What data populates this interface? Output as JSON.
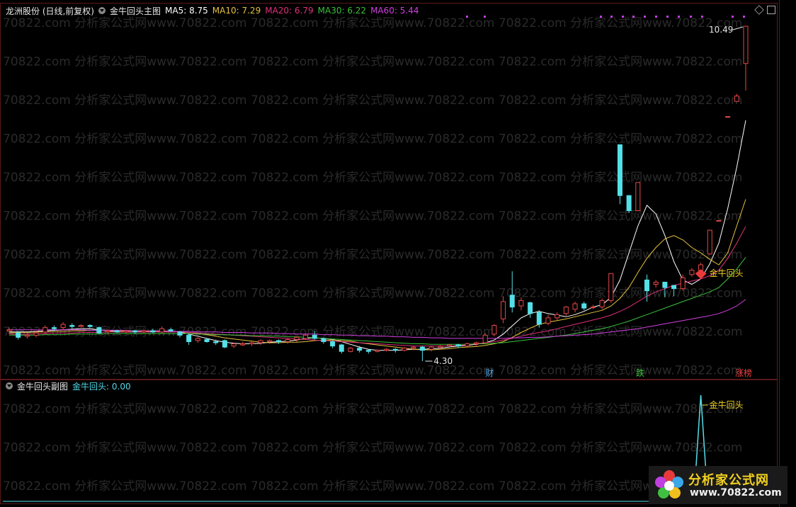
{
  "stock_title": "龙洲股份 (日线,前复权)",
  "main_indicator": "金牛回头主图",
  "ma": [
    {
      "label": "MA5: 8.75",
      "color": "#ffffff"
    },
    {
      "label": "MA10: 7.29",
      "color": "#e6c23c"
    },
    {
      "label": "MA20: 6.79",
      "color": "#e0307a"
    },
    {
      "label": "MA30: 6.22",
      "color": "#3cc03c"
    },
    {
      "label": "MA60: 5.44",
      "color": "#d040e0"
    }
  ],
  "sub_indicator": "金牛回头副图",
  "sub_value": "金牛回头: 0.00",
  "logo": {
    "cn": "分析家公式网",
    "url": "www.70822.com"
  },
  "watermark": "70822.com  分析家公式网www.70822.com",
  "chart_data": {
    "type": "candlestick",
    "title": "龙洲股份 (日线,前复权)",
    "high_label": "10.49",
    "low_label": "4.30",
    "signal_label": "金牛回头",
    "event_labels": [
      {
        "text": "财",
        "color": "#4fa8e8"
      },
      {
        "text": "跌",
        "color": "#3cc03c"
      },
      {
        "text": "涨榜",
        "color": "#e84040"
      }
    ],
    "candles": [
      [
        4.86,
        4.88,
        4.8,
        4.92
      ],
      [
        4.82,
        4.74,
        4.7,
        4.86
      ],
      [
        4.76,
        4.78,
        4.72,
        4.82
      ],
      [
        4.78,
        4.82,
        4.74,
        4.86
      ],
      [
        4.84,
        4.92,
        4.8,
        4.96
      ],
      [
        4.92,
        4.9,
        4.86,
        4.96
      ],
      [
        4.92,
        4.98,
        4.88,
        5.02
      ],
      [
        4.96,
        4.94,
        4.9,
        5.0
      ],
      [
        4.94,
        4.96,
        4.92,
        4.98
      ],
      [
        4.96,
        4.94,
        4.92,
        4.98
      ],
      [
        4.92,
        4.82,
        4.8,
        4.94
      ],
      [
        4.84,
        4.86,
        4.8,
        4.88
      ],
      [
        4.86,
        4.84,
        4.82,
        4.88
      ],
      [
        4.84,
        4.86,
        4.82,
        4.88
      ],
      [
        4.86,
        4.84,
        4.8,
        4.88
      ],
      [
        4.84,
        4.86,
        4.82,
        4.88
      ],
      [
        4.86,
        4.84,
        4.82,
        4.9
      ],
      [
        4.84,
        4.9,
        4.82,
        4.94
      ],
      [
        4.88,
        4.86,
        4.84,
        4.92
      ],
      [
        4.84,
        4.78,
        4.74,
        4.86
      ],
      [
        4.78,
        4.66,
        4.6,
        4.8
      ],
      [
        4.68,
        4.72,
        4.64,
        4.74
      ],
      [
        4.7,
        4.66,
        4.64,
        4.72
      ],
      [
        4.66,
        4.64,
        4.6,
        4.7
      ],
      [
        4.68,
        4.56,
        4.54,
        4.7
      ],
      [
        4.58,
        4.62,
        4.54,
        4.64
      ],
      [
        4.6,
        4.62,
        4.58,
        4.66
      ],
      [
        4.62,
        4.64,
        4.58,
        4.66
      ],
      [
        4.64,
        4.68,
        4.6,
        4.7
      ],
      [
        4.66,
        4.68,
        4.62,
        4.7
      ],
      [
        4.68,
        4.66,
        4.62,
        4.7
      ],
      [
        4.66,
        4.7,
        4.62,
        4.72
      ],
      [
        4.7,
        4.74,
        4.66,
        4.76
      ],
      [
        4.72,
        4.78,
        4.7,
        4.8
      ],
      [
        4.78,
        4.72,
        4.7,
        4.86
      ],
      [
        4.72,
        4.66,
        4.62,
        4.74
      ],
      [
        4.66,
        4.58,
        4.54,
        4.68
      ],
      [
        4.6,
        4.48,
        4.44,
        4.62
      ],
      [
        4.48,
        4.54,
        4.46,
        4.56
      ],
      [
        4.54,
        4.5,
        4.46,
        4.58
      ],
      [
        4.5,
        4.48,
        4.44,
        4.52
      ],
      [
        4.48,
        4.5,
        4.46,
        4.52
      ],
      [
        4.5,
        4.52,
        4.48,
        4.54
      ],
      [
        4.52,
        4.5,
        4.46,
        4.54
      ],
      [
        4.5,
        4.54,
        4.48,
        4.56
      ],
      [
        4.54,
        4.56,
        4.5,
        4.58
      ],
      [
        4.56,
        4.5,
        4.3,
        4.58
      ],
      [
        4.52,
        4.56,
        4.48,
        4.58
      ],
      [
        4.56,
        4.58,
        4.52,
        4.6
      ],
      [
        4.58,
        4.6,
        4.54,
        4.62
      ],
      [
        4.6,
        4.58,
        4.54,
        4.62
      ],
      [
        4.58,
        4.62,
        4.56,
        4.64
      ],
      [
        4.62,
        4.64,
        4.58,
        4.66
      ],
      [
        4.64,
        4.78,
        4.62,
        4.82
      ],
      [
        4.8,
        4.96,
        4.76,
        4.98
      ],
      [
        5.08,
        5.4,
        5.0,
        5.5
      ],
      [
        5.52,
        5.3,
        5.2,
        5.96
      ],
      [
        5.32,
        5.42,
        5.24,
        5.48
      ],
      [
        5.38,
        5.18,
        5.1,
        5.4
      ],
      [
        5.2,
        4.98,
        4.92,
        5.24
      ],
      [
        5.0,
        5.1,
        4.96,
        5.16
      ],
      [
        5.1,
        5.16,
        5.06,
        5.2
      ],
      [
        5.18,
        5.3,
        5.14,
        5.32
      ],
      [
        5.26,
        5.36,
        5.2,
        5.4
      ],
      [
        5.36,
        5.28,
        5.24,
        5.4
      ],
      [
        5.3,
        5.3,
        5.26,
        5.34
      ],
      [
        5.3,
        5.42,
        5.26,
        5.46
      ],
      [
        5.42,
        5.92,
        5.38,
        5.92
      ],
      [
        8.3,
        7.36,
        7.2,
        8.3
      ],
      [
        7.36,
        7.08,
        7.04,
        7.1
      ],
      [
        7.08,
        7.6,
        7.08,
        7.6
      ],
      [
        5.8,
        5.6,
        5.4,
        5.9
      ],
      [
        5.72,
        5.76,
        5.66,
        5.8
      ],
      [
        5.76,
        5.66,
        5.48,
        5.74
      ],
      [
        5.7,
        5.64,
        5.5,
        5.7
      ],
      [
        5.64,
        5.84,
        5.6,
        5.9
      ],
      [
        5.9,
        5.98,
        5.86,
        6.02
      ],
      [
        5.98,
        6.08,
        5.96,
        6.12
      ],
      [
        6.28,
        6.72,
        6.28,
        6.72
      ],
      [
        6.9,
        6.9,
        6.9,
        6.9
      ],
      [
        8.82,
        8.82,
        8.82,
        8.82
      ],
      [
        9.1,
        9.2,
        9.1,
        9.24
      ],
      [
        9.8,
        10.49,
        9.3,
        10.49
      ]
    ],
    "ma_series": [
      {
        "name": "MA5",
        "color": "#ffffff",
        "values": [
          4.84,
          4.84,
          4.84,
          4.85,
          4.86,
          4.87,
          4.88,
          4.89,
          4.9,
          4.9,
          4.88,
          4.86,
          4.84,
          4.84,
          4.84,
          4.85,
          4.85,
          4.86,
          4.85,
          4.84,
          4.8,
          4.76,
          4.72,
          4.68,
          4.65,
          4.63,
          4.62,
          4.62,
          4.63,
          4.65,
          4.66,
          4.67,
          4.69,
          4.72,
          4.73,
          4.72,
          4.7,
          4.66,
          4.61,
          4.56,
          4.52,
          4.5,
          4.5,
          4.5,
          4.51,
          4.52,
          4.52,
          4.53,
          4.54,
          4.56,
          4.58,
          4.59,
          4.61,
          4.64,
          4.69,
          4.8,
          4.95,
          5.1,
          5.18,
          5.22,
          5.18,
          5.15,
          5.12,
          5.16,
          5.22,
          5.3,
          5.34,
          5.48,
          5.8,
          6.3,
          6.8,
          7.18,
          7.02,
          6.62,
          6.14,
          5.8,
          5.72,
          5.82,
          6.1,
          6.48,
          7.12,
          7.88,
          8.75
        ]
      },
      {
        "name": "MA10",
        "color": "#e6c23c",
        "values": [
          4.82,
          4.83,
          4.83,
          4.84,
          4.84,
          4.85,
          4.85,
          4.86,
          4.86,
          4.87,
          4.87,
          4.87,
          4.86,
          4.86,
          4.86,
          4.86,
          4.85,
          4.85,
          4.85,
          4.84,
          4.83,
          4.81,
          4.79,
          4.76,
          4.73,
          4.71,
          4.69,
          4.67,
          4.65,
          4.64,
          4.64,
          4.65,
          4.65,
          4.66,
          4.68,
          4.69,
          4.69,
          4.68,
          4.67,
          4.64,
          4.62,
          4.6,
          4.58,
          4.56,
          4.54,
          4.52,
          4.51,
          4.51,
          4.52,
          4.53,
          4.55,
          4.56,
          4.57,
          4.59,
          4.62,
          4.66,
          4.74,
          4.83,
          4.91,
          4.98,
          5.02,
          5.05,
          5.08,
          5.12,
          5.16,
          5.2,
          5.24,
          5.32,
          5.46,
          5.66,
          5.94,
          6.2,
          6.4,
          6.56,
          6.62,
          6.54,
          6.4,
          6.3,
          6.18,
          6.08,
          6.3,
          6.8,
          7.29
        ]
      },
      {
        "name": "MA20",
        "color": "#e0307a",
        "values": [
          4.8,
          4.8,
          4.8,
          4.81,
          4.81,
          4.82,
          4.82,
          4.82,
          4.83,
          4.83,
          4.83,
          4.84,
          4.84,
          4.84,
          4.84,
          4.84,
          4.84,
          4.84,
          4.84,
          4.84,
          4.83,
          4.82,
          4.81,
          4.8,
          4.79,
          4.78,
          4.77,
          4.76,
          4.75,
          4.74,
          4.73,
          4.72,
          4.71,
          4.7,
          4.69,
          4.68,
          4.67,
          4.66,
          4.65,
          4.64,
          4.63,
          4.62,
          4.61,
          4.6,
          4.59,
          4.58,
          4.58,
          4.58,
          4.58,
          4.58,
          4.59,
          4.6,
          4.62,
          4.64,
          4.66,
          4.69,
          4.72,
          4.76,
          4.8,
          4.83,
          4.86,
          4.9,
          4.94,
          4.98,
          5.02,
          5.06,
          5.1,
          5.15,
          5.22,
          5.3,
          5.4,
          5.5,
          5.58,
          5.64,
          5.7,
          5.74,
          5.78,
          5.82,
          5.88,
          5.98,
          6.2,
          6.48,
          6.79
        ]
      },
      {
        "name": "MA30",
        "color": "#3cc03c",
        "values": [
          4.78,
          4.78,
          4.78,
          4.78,
          4.79,
          4.79,
          4.79,
          4.8,
          4.8,
          4.8,
          4.8,
          4.81,
          4.81,
          4.81,
          4.81,
          4.81,
          4.81,
          4.81,
          4.81,
          4.81,
          4.81,
          4.8,
          4.8,
          4.79,
          4.79,
          4.78,
          4.78,
          4.77,
          4.77,
          4.76,
          4.76,
          4.75,
          4.75,
          4.74,
          4.73,
          4.72,
          4.71,
          4.7,
          4.69,
          4.68,
          4.67,
          4.66,
          4.65,
          4.64,
          4.63,
          4.62,
          4.62,
          4.61,
          4.61,
          4.61,
          4.61,
          4.61,
          4.62,
          4.62,
          4.63,
          4.64,
          4.66,
          4.68,
          4.7,
          4.72,
          4.74,
          4.76,
          4.78,
          4.81,
          4.84,
          4.87,
          4.9,
          4.94,
          4.99,
          5.04,
          5.1,
          5.16,
          5.22,
          5.28,
          5.34,
          5.4,
          5.46,
          5.52,
          5.58,
          5.66,
          5.82,
          6.0,
          6.22
        ]
      },
      {
        "name": "MA60",
        "color": "#d040e0",
        "values": [
          4.88,
          4.88,
          4.88,
          4.88,
          4.88,
          4.88,
          4.88,
          4.88,
          4.88,
          4.87,
          4.87,
          4.87,
          4.87,
          4.87,
          4.86,
          4.86,
          4.86,
          4.86,
          4.85,
          4.85,
          4.85,
          4.84,
          4.84,
          4.84,
          4.83,
          4.83,
          4.83,
          4.82,
          4.82,
          4.82,
          4.81,
          4.81,
          4.8,
          4.8,
          4.8,
          4.79,
          4.79,
          4.78,
          4.78,
          4.77,
          4.77,
          4.76,
          4.76,
          4.75,
          4.75,
          4.74,
          4.74,
          4.73,
          4.73,
          4.72,
          4.72,
          4.72,
          4.72,
          4.72,
          4.72,
          4.72,
          4.73,
          4.73,
          4.74,
          4.74,
          4.75,
          4.76,
          4.77,
          4.78,
          4.79,
          4.8,
          4.82,
          4.84,
          4.86,
          4.88,
          4.9,
          4.93,
          4.96,
          4.99,
          5.02,
          5.05,
          5.08,
          5.11,
          5.14,
          5.18,
          5.24,
          5.32,
          5.44
        ]
      }
    ],
    "signal_index": 77,
    "sub_series": {
      "name": "金牛回头",
      "values_at_signal": 1,
      "last": 0
    }
  }
}
